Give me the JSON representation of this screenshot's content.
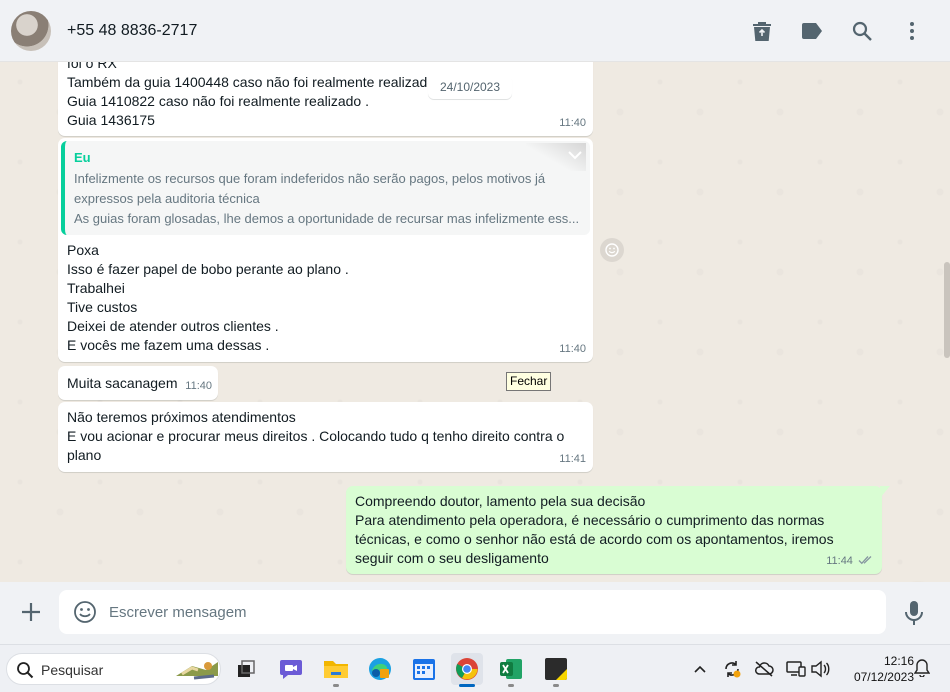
{
  "header": {
    "contact_name": "+55 48 8836-2717",
    "actions": [
      "delete-icon",
      "label-icon",
      "search-icon",
      "menu-icon"
    ]
  },
  "messages": {
    "m1": {
      "lines": "foi o RX\nTambém da guia 1400448 caso não foi realmente realizado\nGuia 1410822 caso não foi realmente realizado .\nGuia 1436175",
      "time": "11:40"
    },
    "date_divider": "24/10/2023",
    "m2": {
      "quote_author": "Eu",
      "quote_line1": "Infelizmente os recursos que foram indeferidos não serão pagos, pelos motivos já",
      "quote_line2": "expressos pela auditoria técnica",
      "quote_line3": "As guias foram glosadas, lhe demos a oportunidade de recursar mas infelizmente ess...",
      "body": "Poxa\nIsso é fazer papel de bobo perante ao plano .\nTrabalhei\nTive custos\nDeixei de atender outros clientes .\nE vocês me fazem uma dessas .",
      "time": "11:40"
    },
    "m3": {
      "text": "Muita sacanagem",
      "time": "11:40"
    },
    "tooltip": "Fechar",
    "m4": {
      "text": "Não teremos próximos atendimentos\nE vou acionar e procurar meus direitos . Colocando tudo q tenho direito contra o\nplano",
      "time": "11:41"
    },
    "m5": {
      "text": "Compreendo doutor, lamento pela sua decisão\nPara atendimento pela operadora, é necessário o cumprimento das normas\ntécnicas, e como o senhor não está de acordo com os apontamentos, iremos\nseguir com o seu desligamento",
      "time": "11:44"
    }
  },
  "composer": {
    "placeholder": "Escrever mensagem"
  },
  "taskbar": {
    "search_label": "Pesquisar",
    "apps": [
      "task-view",
      "meet",
      "file-explorer",
      "edge",
      "calendar",
      "chrome",
      "excel",
      "sticky-notes"
    ],
    "time": "12:16",
    "date": "07/12/2023"
  },
  "colors": {
    "outgoing_bubble": "#d9fdd3",
    "accent_green": "#06cf9c",
    "chat_background": "#efeae2"
  }
}
